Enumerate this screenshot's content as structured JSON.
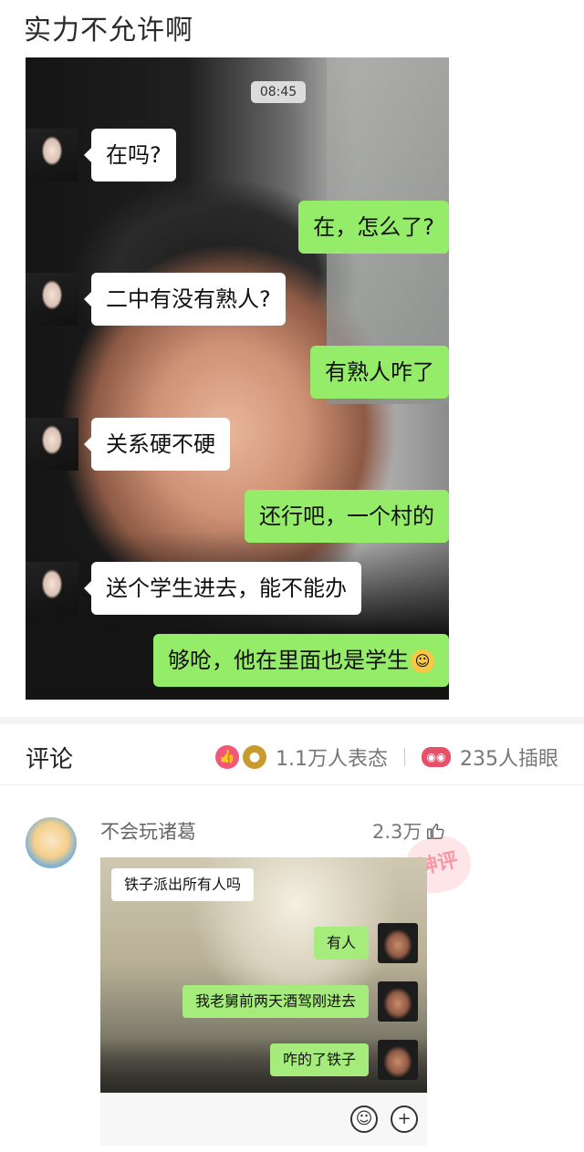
{
  "post": {
    "title": "实力不允许啊"
  },
  "chat": {
    "time": "08:45",
    "messages": [
      {
        "side": "in",
        "text": "在吗?"
      },
      {
        "side": "out",
        "text": "在，怎么了?"
      },
      {
        "side": "in",
        "text": "二中有没有熟人?"
      },
      {
        "side": "out",
        "text": "有熟人咋了"
      },
      {
        "side": "in",
        "text": "关系硬不硬"
      },
      {
        "side": "out",
        "text": "还行吧，一个村的"
      },
      {
        "side": "in",
        "text": "送个学生进去，能不能办"
      },
      {
        "side": "out",
        "text": "够呛，他在里面也是学生"
      }
    ]
  },
  "comments": {
    "title": "评论",
    "reactions": "1.1万人表态",
    "eyes": "235人插眼"
  },
  "comment": {
    "user": "不会玩诸葛",
    "likes": "2.3万",
    "image_messages": [
      {
        "side": "in",
        "text": "铁子派出所有人吗"
      },
      {
        "side": "out",
        "text": "有人"
      },
      {
        "side": "out",
        "text": "我老舅前两天酒驾刚进去"
      },
      {
        "side": "out",
        "text": "咋的了铁子"
      }
    ]
  }
}
